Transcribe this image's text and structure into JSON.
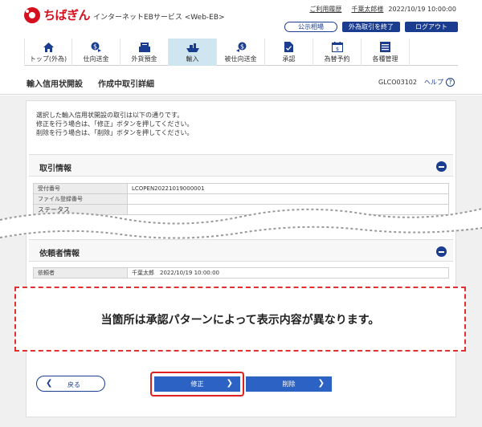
{
  "header": {
    "logo_text": "ちばぎん",
    "service_name": "インターネットEBサービス <Web-EB>",
    "usage_history": "ご利用履歴",
    "user_name": "千葉太郎様",
    "datetime": "2022/10/19 10:00:00",
    "public_rates": "公示相場",
    "fx_end": "外為取引を終了",
    "logout": "ログアウト"
  },
  "nav": [
    {
      "label": "トップ(外為)",
      "icon": "home-icon"
    },
    {
      "label": "仕向送金",
      "icon": "outward-remittance-icon"
    },
    {
      "label": "外貨預金",
      "icon": "fx-deposit-icon"
    },
    {
      "label": "輸入",
      "icon": "import-icon",
      "active": true
    },
    {
      "label": "被仕向送金",
      "icon": "inward-remittance-icon"
    },
    {
      "label": "承認",
      "icon": "approval-icon"
    },
    {
      "label": "為替予約",
      "icon": "fx-contract-icon"
    },
    {
      "label": "各種管理",
      "icon": "management-icon"
    }
  ],
  "title": {
    "main": "輸入信用状開設",
    "sub": "作成中取引詳細",
    "screen_id": "GLCO03102",
    "help": "ヘルプ"
  },
  "intro": [
    "選択した輸入信用状開設の取引は以下の通りです。",
    "修正を行う場合は、「修正」ボタンを押してください。",
    "削除を行う場合は、「削除」ボタンを押してください。"
  ],
  "transaction_info": {
    "heading": "取引情報",
    "rows": [
      {
        "label": "受付番号",
        "value": "LCOPEN20221019000001"
      },
      {
        "label": "ファイル登録番号",
        "value": ""
      },
      {
        "label": "ステータス",
        "value": ""
      }
    ]
  },
  "requester_info": {
    "heading": "依頼者情報",
    "rows": [
      {
        "label": "依頼者",
        "value": "千葉太郎　2022/10/19 10:00:00"
      }
    ]
  },
  "notice": "当箇所は承認パターンによって表示内容が異なります。",
  "buttons": {
    "back": "戻る",
    "modify": "修正",
    "delete": "削除"
  },
  "colors": {
    "brand_red": "#d40f1e",
    "navy": "#1a3d8f",
    "button_blue": "#2c62c4",
    "active_tab": "#cfe6f0",
    "highlight_red": "#e02020"
  }
}
